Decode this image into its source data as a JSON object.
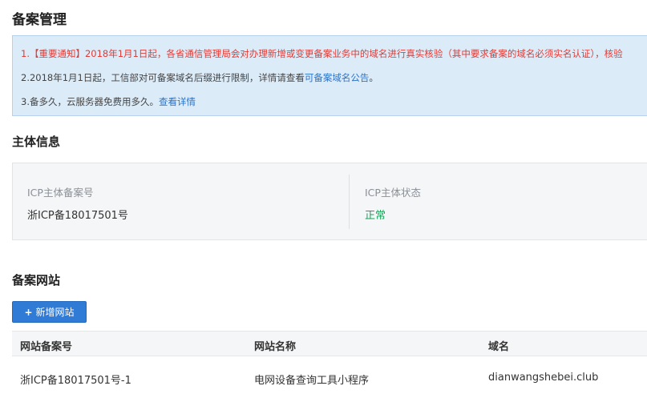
{
  "page": {
    "title": "备案管理"
  },
  "notice": {
    "line1": "1.【重要通知】2018年1月1日起，各省通信管理局会对办理新增或变更备案业务中的域名进行真实核验（其中要求备案的域名必须实名认证），核验",
    "line2_text": "2.2018年1月1日起，工信部对可备案域名后缀进行限制，详情请查看",
    "line2_link": "可备案域名公告",
    "line2_end": "。",
    "line3_text": "3.备多久，云服务器免费用多久。",
    "line3_link": "查看详情"
  },
  "subject": {
    "title": "主体信息",
    "icp_label": "ICP主体备案号",
    "icp_value": "浙ICP备18017501号",
    "status_label": "ICP主体状态",
    "status_value": "正常"
  },
  "sites": {
    "title": "备案网站",
    "add_button": "新增网站",
    "add_icon": "+",
    "columns": [
      "网站备案号",
      "网站名称",
      "域名"
    ],
    "rows": [
      [
        "浙ICP备18017501号-1",
        "电网设备查询工具小程序",
        "dianwangshebei.club"
      ]
    ]
  },
  "colors": {
    "notice_bg": "#dcebf8",
    "notice_alert": "#e23b35",
    "link": "#2b73c9",
    "status_ok": "#19a35a",
    "primary_button": "#2f7bd5"
  }
}
